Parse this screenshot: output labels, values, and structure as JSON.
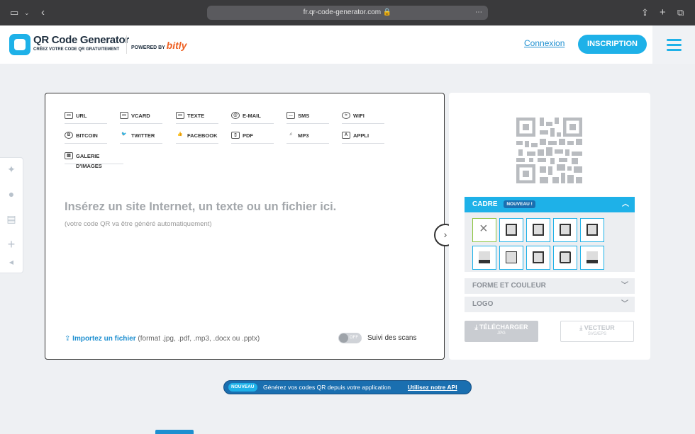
{
  "browser": {
    "url": "fr.qr-code-generator.com",
    "icons": [
      "sidebar-icon",
      "chevron-down-icon",
      "back-icon",
      "lock-icon",
      "more-icon",
      "share-icon",
      "plus-icon",
      "tabs-icon"
    ]
  },
  "header": {
    "brand": "QR Code Generator",
    "tagline": "CRÉEZ VOTRE CODE QR GRATUITEMENT",
    "powered_by": "POWERED BY",
    "partner": "bitly",
    "login": "Connexion",
    "signup": "INSCRIPTION"
  },
  "tabs": [
    {
      "label": "URL",
      "icon": "url-icon"
    },
    {
      "label": "VCARD",
      "icon": "vcard-icon"
    },
    {
      "label": "TEXTE",
      "icon": "text-icon"
    },
    {
      "label": "E-MAIL",
      "icon": "email-icon"
    },
    {
      "label": "SMS",
      "icon": "sms-icon"
    },
    {
      "label": "WIFI",
      "icon": "wifi-icon"
    },
    {
      "label": "BITCOIN",
      "icon": "bitcoin-icon"
    },
    {
      "label": "TWITTER",
      "icon": "twitter-icon"
    },
    {
      "label": "FACEBOOK",
      "icon": "facebook-icon"
    },
    {
      "label": "PDF",
      "icon": "pdf-icon"
    },
    {
      "label": "MP3",
      "icon": "mp3-icon"
    },
    {
      "label": "APPLI",
      "icon": "app-icon"
    },
    {
      "label": "GALERIE D'IMAGES",
      "icon": "image-gallery-icon"
    }
  ],
  "editor": {
    "placeholder": "Insérez un site Internet, un texte ou un fichier ici.",
    "subtext": "(votre code QR va être généré automatiquement)",
    "import_link": "Importez un fichier",
    "import_formats": " (format .jpg, .pdf, .mp3, .docx ou .pptx)",
    "toggle_state": "OFF",
    "toggle_label": "Suivi des scans"
  },
  "sidebar": {
    "frames_title": "CADRE",
    "frames_badge": "NOUVEAU !",
    "frame_count": 10,
    "selected_frame": "none",
    "shape_color": "FORME ET COULEUR",
    "logo": "LOGO",
    "download_label": "TÉLÉCHARGER",
    "download_format": "JPG",
    "vector_label": "VECTEUR",
    "vector_format": "SVG/EPS"
  },
  "banner": {
    "badge": "NOUVEAU",
    "text": "Générez vos codes QR depuis votre application",
    "link": "Utilisez notre API"
  },
  "colors": {
    "accent": "#1eb1e8",
    "dark_blue": "#1a6fb0",
    "bitly": "#ee6123",
    "selected": "#8cc43f"
  }
}
